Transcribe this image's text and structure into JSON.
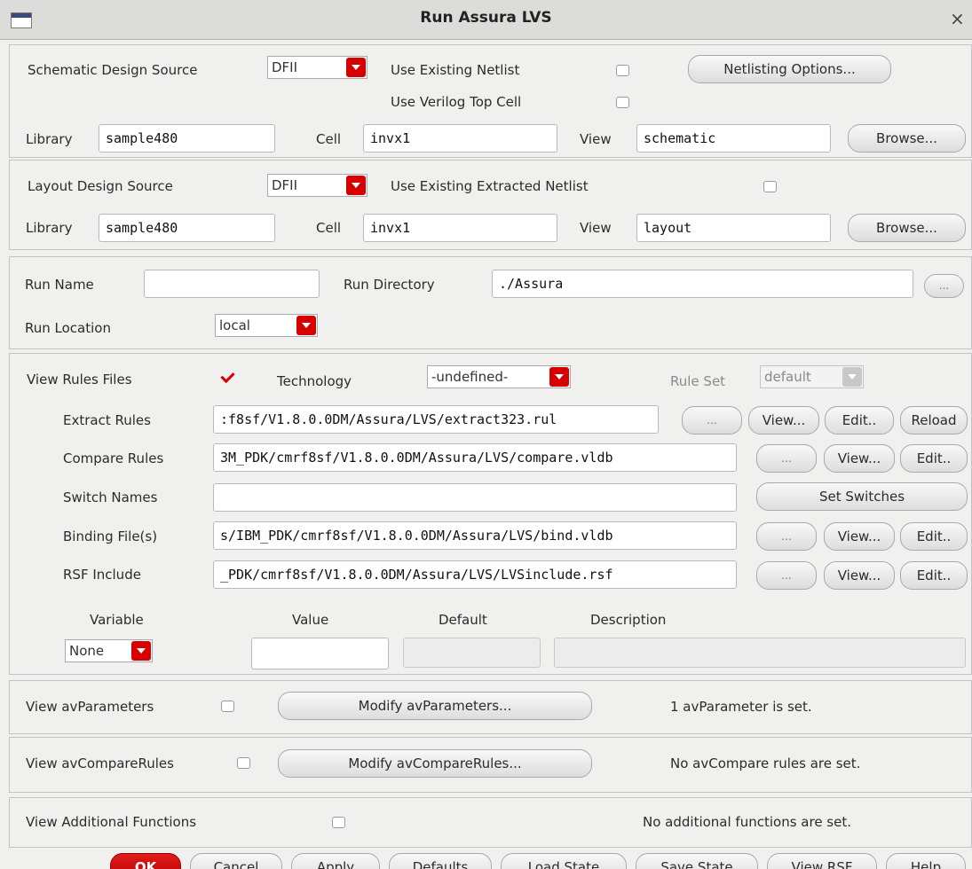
{
  "window": {
    "title": "Run Assura LVS"
  },
  "schematic": {
    "source_label": "Schematic Design Source",
    "source_value": "DFII",
    "use_existing_netlist": "Use Existing Netlist",
    "use_verilog_top_cell": "Use Verilog Top Cell",
    "netlisting_options": "Netlisting Options...",
    "library_label": "Library",
    "library_value": "sample480",
    "cell_label": "Cell",
    "cell_value": "invx1",
    "view_label": "View",
    "view_value": "schematic",
    "browse": "Browse..."
  },
  "layout": {
    "source_label": "Layout Design Source",
    "source_value": "DFII",
    "use_existing_extracted": "Use Existing Extracted Netlist",
    "library_label": "Library",
    "library_value": "sample480",
    "cell_label": "Cell",
    "cell_value": "invx1",
    "view_label": "View",
    "view_value": "layout",
    "browse": "Browse..."
  },
  "run": {
    "name_label": "Run Name",
    "name_value": "",
    "directory_label": "Run Directory",
    "directory_value": "./Assura",
    "ellipsis": "...",
    "location_label": "Run Location",
    "location_value": "local"
  },
  "rules": {
    "view_rules_files": "View Rules Files",
    "technology_label": "Technology",
    "technology_value": "-undefined-",
    "rule_set_label": "Rule Set",
    "rule_set_value": "default",
    "extract_label": "Extract Rules",
    "extract_value": ":f8sf/V1.8.0.0DM/Assura/LVS/extract323.rul",
    "compare_label": "Compare Rules",
    "compare_value": "3M_PDK/cmrf8sf/V1.8.0.0DM/Assura/LVS/compare.vldb",
    "switch_label": "Switch Names",
    "switch_value": "",
    "set_switches": "Set Switches",
    "binding_label": "Binding File(s)",
    "binding_value": "s/IBM_PDK/cmrf8sf/V1.8.0.0DM/Assura/LVS/bind.vldb",
    "rsf_label": "RSF Include",
    "rsf_value": "_PDK/cmrf8sf/V1.8.0.0DM/Assura/LVS/LVSinclude.rsf",
    "ellipsis": "...",
    "view": "View...",
    "edit": "Edit..",
    "reload": "Reload",
    "variable_header": "Variable",
    "value_header": "Value",
    "default_header": "Default",
    "description_header": "Description",
    "variable_value": "None"
  },
  "av_parameters": {
    "label": "View avParameters",
    "button": "Modify avParameters...",
    "status": "1 avParameter is set."
  },
  "av_compare": {
    "label": "View avCompareRules",
    "button": "Modify avCompareRules...",
    "status": "No avCompare rules are set."
  },
  "additional": {
    "label": "View Additional Functions",
    "status": "No additional functions are set."
  },
  "footer": {
    "ok": "OK",
    "cancel": "Cancel",
    "apply": "Apply",
    "defaults": "Defaults",
    "load_state": "Load State",
    "save_state": "Save State",
    "view_rsf": "View RSF",
    "help": "Help"
  }
}
